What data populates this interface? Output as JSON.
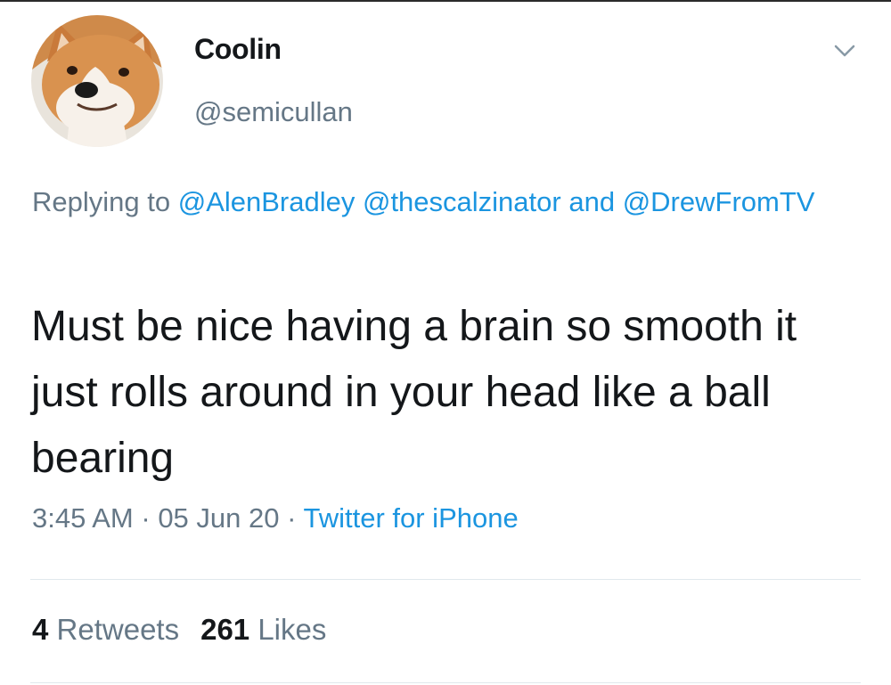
{
  "user": {
    "display_name": "Coolin",
    "handle": "@semicullan",
    "avatar_icon": "corgi-avatar"
  },
  "menu_icon": "chevron-down-icon",
  "reply": {
    "prefix": "Replying to",
    "mentions": [
      "@AlenBradley",
      "@thescalzinator",
      "@DrewFromTV"
    ],
    "conjunction": "and"
  },
  "tweet": {
    "text": "Must be nice having a brain so smooth it just rolls around in your head like a ball bearing"
  },
  "meta": {
    "time": "3:45 AM",
    "separator": " · ",
    "date": "05 Jun 20",
    "source": "Twitter for iPhone"
  },
  "stats": {
    "retweets_count": "4",
    "retweets_label": "Retweets",
    "likes_count": "261",
    "likes_label": "Likes"
  },
  "colors": {
    "text": "#14171a",
    "secondary": "#657786",
    "link": "#1b95e0",
    "divider": "#e1e8ed"
  }
}
